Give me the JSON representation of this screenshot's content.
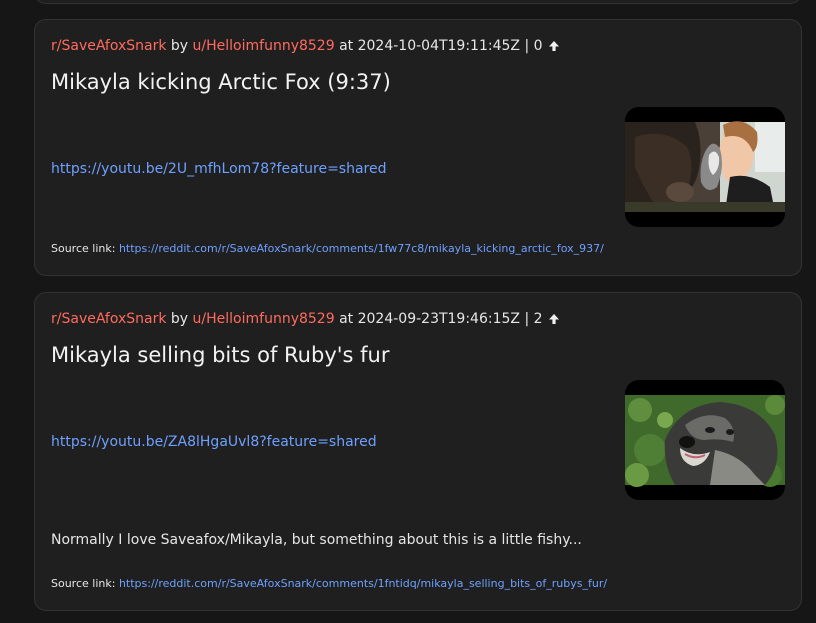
{
  "posts": [
    {
      "subreddit": "r/SaveAfoxSnark",
      "by": "by",
      "author": "u/Helloimfunny8529",
      "at": "at",
      "timestamp": "2024-10-04T19:11:45Z",
      "separator": "|",
      "score": "0",
      "title": "Mikayla kicking Arctic Fox (9:37)",
      "link": "https://youtu.be/2U_mfhLom78?feature=shared",
      "body": "",
      "source_label": "Source link:",
      "source_url": "https://reddit.com/r/SaveAfoxSnark/comments/1fw77c8/mikayla_kicking_arctic_fox_937/",
      "thumbnail_icon": "video-thumbnail-horse-fox-woman"
    },
    {
      "subreddit": "r/SaveAfoxSnark",
      "by": "by",
      "author": "u/Helloimfunny8529",
      "at": "at",
      "timestamp": "2024-09-23T19:46:15Z",
      "separator": "|",
      "score": "2",
      "title": "Mikayla selling bits of Ruby's fur",
      "link": "https://youtu.be/ZA8lHgaUvl8?feature=shared",
      "body": "Normally I love Saveafox/Mikayla, but something about this is a little fishy...",
      "source_label": "Source link:",
      "source_url": "https://reddit.com/r/SaveAfoxSnark/comments/1fntidq/mikayla_selling_bits_of_rubys_fur/",
      "thumbnail_icon": "video-thumbnail-fox-face"
    }
  ],
  "icons": {
    "upvote": "upvote-arrow-icon"
  },
  "colors": {
    "background": "#161616",
    "card": "#1f1f1f",
    "accent": "#ff6b5f",
    "link": "#6ea0ff",
    "text": "#e6e6e6"
  }
}
